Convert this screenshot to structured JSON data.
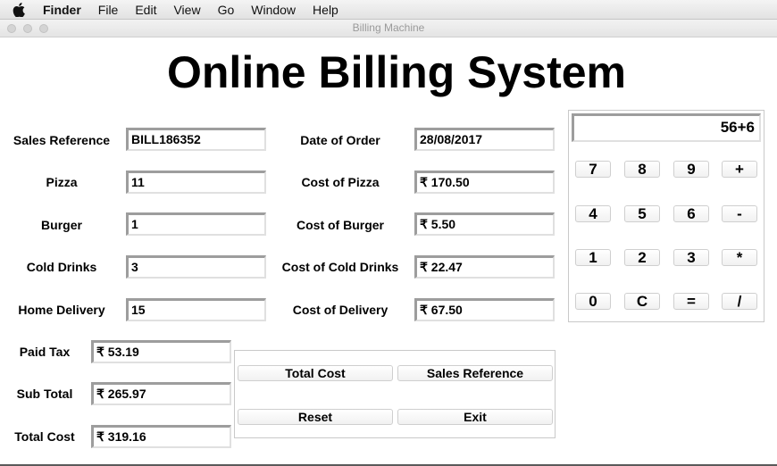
{
  "menubar": {
    "icon": "apple-icon",
    "items": [
      "Finder",
      "File",
      "Edit",
      "View",
      "Go",
      "Window",
      "Help"
    ]
  },
  "window": {
    "title": "Billing Machine"
  },
  "heading": "Online Billing System",
  "order": {
    "sales_reference_label": "Sales Reference",
    "sales_reference_value": "BILL186352",
    "pizza_label": "Pizza",
    "pizza_value": "11",
    "burger_label": "Burger",
    "burger_value": "1",
    "cold_drinks_label": "Cold Drinks",
    "cold_drinks_value": "3",
    "home_delivery_label": "Home Delivery",
    "home_delivery_value": "15"
  },
  "costs": {
    "date_label": "Date of Order",
    "date_value": "28/08/2017",
    "pizza_cost_label": "Cost of Pizza",
    "pizza_cost_value": "₹ 170.50",
    "burger_cost_label": "Cost of Burger",
    "burger_cost_value": "₹ 5.50",
    "cold_drinks_cost_label": "Cost of Cold Drinks",
    "cold_drinks_cost_value": "₹ 22.47",
    "delivery_cost_label": "Cost of Delivery",
    "delivery_cost_value": "₹ 67.50"
  },
  "totals": {
    "paid_tax_label": "Paid Tax",
    "paid_tax_value": "₹ 53.19",
    "sub_total_label": "Sub Total",
    "sub_total_value": "₹ 265.97",
    "total_cost_label": "Total Cost",
    "total_cost_value": "₹ 319.16"
  },
  "buttons": {
    "total_cost": "Total Cost",
    "sales_reference": "Sales Reference",
    "reset": "Reset",
    "exit": "Exit"
  },
  "calculator": {
    "display": "56+6",
    "keys": [
      "7",
      "8",
      "9",
      "+",
      "4",
      "5",
      "6",
      "-",
      "1",
      "2",
      "3",
      "*",
      "0",
      "C",
      "=",
      "/"
    ]
  }
}
